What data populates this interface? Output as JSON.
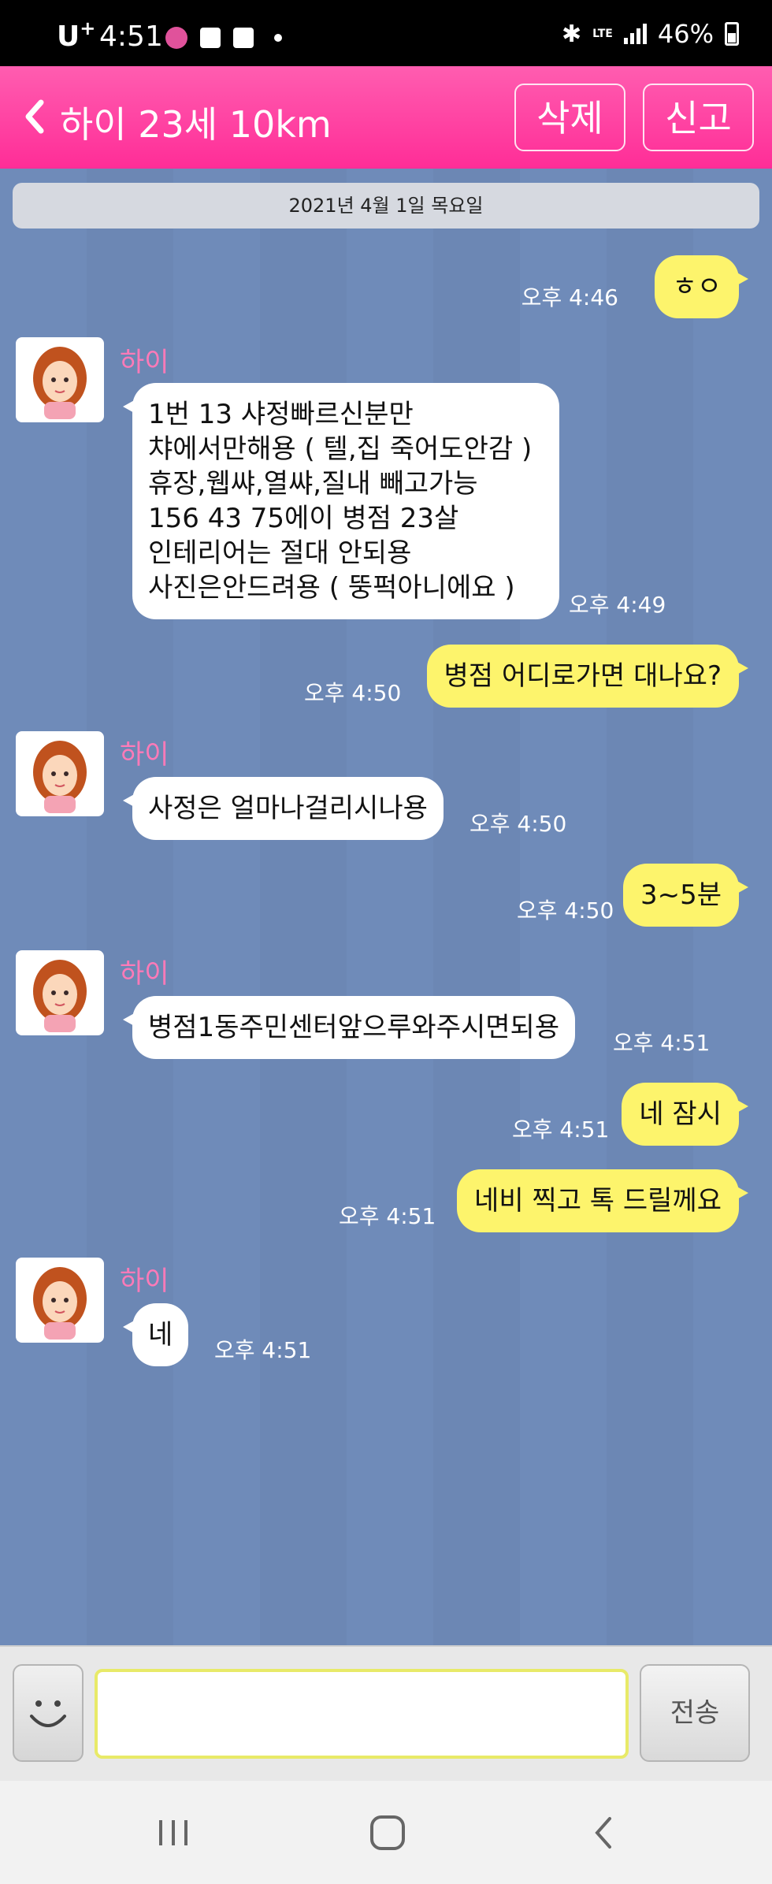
{
  "status_bar": {
    "carrier": "U",
    "carrier_sup": "+",
    "time": "4:51",
    "network": "LTE",
    "battery": "46%",
    "icons": [
      "notification-badge-icon",
      "image-icon",
      "note-icon",
      "dot-icon",
      "bluetooth-icon",
      "signal-icon",
      "battery-icon"
    ]
  },
  "header": {
    "title": "하이 23세 10km",
    "delete_label": "삭제",
    "report_label": "신고",
    "bg_color": "#ff2d97"
  },
  "chat": {
    "date": "2021년 4월 1일 목요일",
    "messages": [
      {
        "side": "right",
        "text": "ㅎㅇ",
        "time": "오후 4:46"
      },
      {
        "side": "left",
        "sender": "하이",
        "lines": [
          "1번 13 샤정빠르신분만",
          "챠에서만해용 ( 텔,집 죽어도안감 )",
          "휴장,웹쌰,열쌰,질내 빼고가능",
          "156 43 75에이 병점 23살",
          "인테리어는 절대 안되용",
          "사진은안드려용 ( 뚱퍽아니에요 )"
        ],
        "time": "오후 4:49"
      },
      {
        "side": "right",
        "text": "병점 어디로가면 대나요?",
        "time": "오후 4:50"
      },
      {
        "side": "left",
        "sender": "하이",
        "text": "사정은 얼마나걸리시나용",
        "time": "오후 4:50"
      },
      {
        "side": "right",
        "text": "3~5분",
        "time": "오후 4:50"
      },
      {
        "side": "left",
        "sender": "하이",
        "text": "병점1동주민센터앞으루와주시면되용",
        "time": "오후 4:51"
      },
      {
        "side": "right",
        "text": "네 잠시",
        "time": "오후 4:51"
      },
      {
        "side": "right",
        "text": "네비 찍고 톡 드릴께요",
        "time": "오후 4:51"
      },
      {
        "side": "left",
        "sender": "하이",
        "text": "네",
        "time": "오후 4:51"
      }
    ]
  },
  "input": {
    "value": "",
    "send_label": "전송"
  },
  "nav": {
    "icons": [
      "recent-apps-icon",
      "home-icon",
      "back-nav-icon"
    ]
  }
}
